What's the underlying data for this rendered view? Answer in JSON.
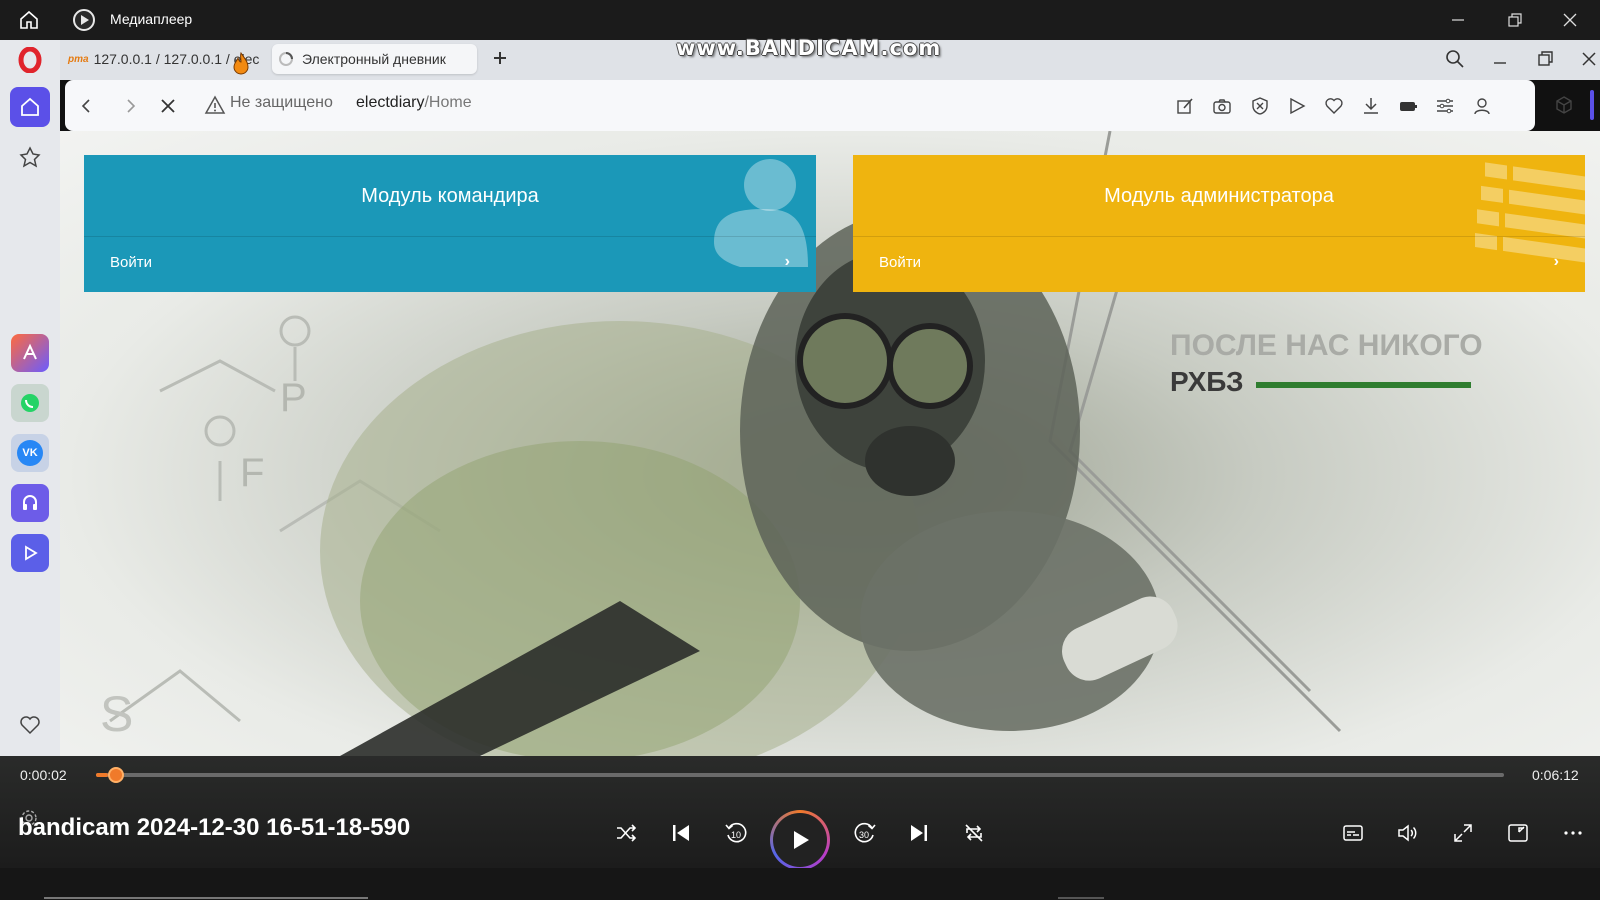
{
  "player": {
    "title": "Медиаплеер",
    "media_title": "bandicam 2024-12-30 16-51-18-590",
    "time_current": "0:00:02",
    "time_total": "0:06:12",
    "progress_fraction": 0.005
  },
  "browser": {
    "tabs": [
      {
        "label": "127.0.0.1 / 127.0.0.1 / elec",
        "favicon": "pma"
      },
      {
        "label": "Электронный дневник",
        "loading": true
      }
    ],
    "address": {
      "security_warning": "Не защищено",
      "host": "electdiary",
      "path": "/Home"
    },
    "sidebar_apps": [
      "app-icon",
      "whatsapp-icon",
      "vk-icon",
      "music-icon",
      "player-icon"
    ]
  },
  "watermark": "www.BANDICAM.com",
  "page": {
    "cards": [
      {
        "title": "Модуль командира",
        "login": "Войти",
        "color": "#1b98b8"
      },
      {
        "title": "Модуль администратора",
        "login": "Войти",
        "color": "#efb40f"
      }
    ],
    "poster_title": "ПОСЛЕ НАС НИКОГО",
    "poster_subtitle": "РХБЗ"
  },
  "colors": {
    "accent_orange": "#f07a2a",
    "player_bg": "#1c1c1c",
    "opera_red": "#e0242c",
    "sidebar_active": "#5b50e8"
  }
}
